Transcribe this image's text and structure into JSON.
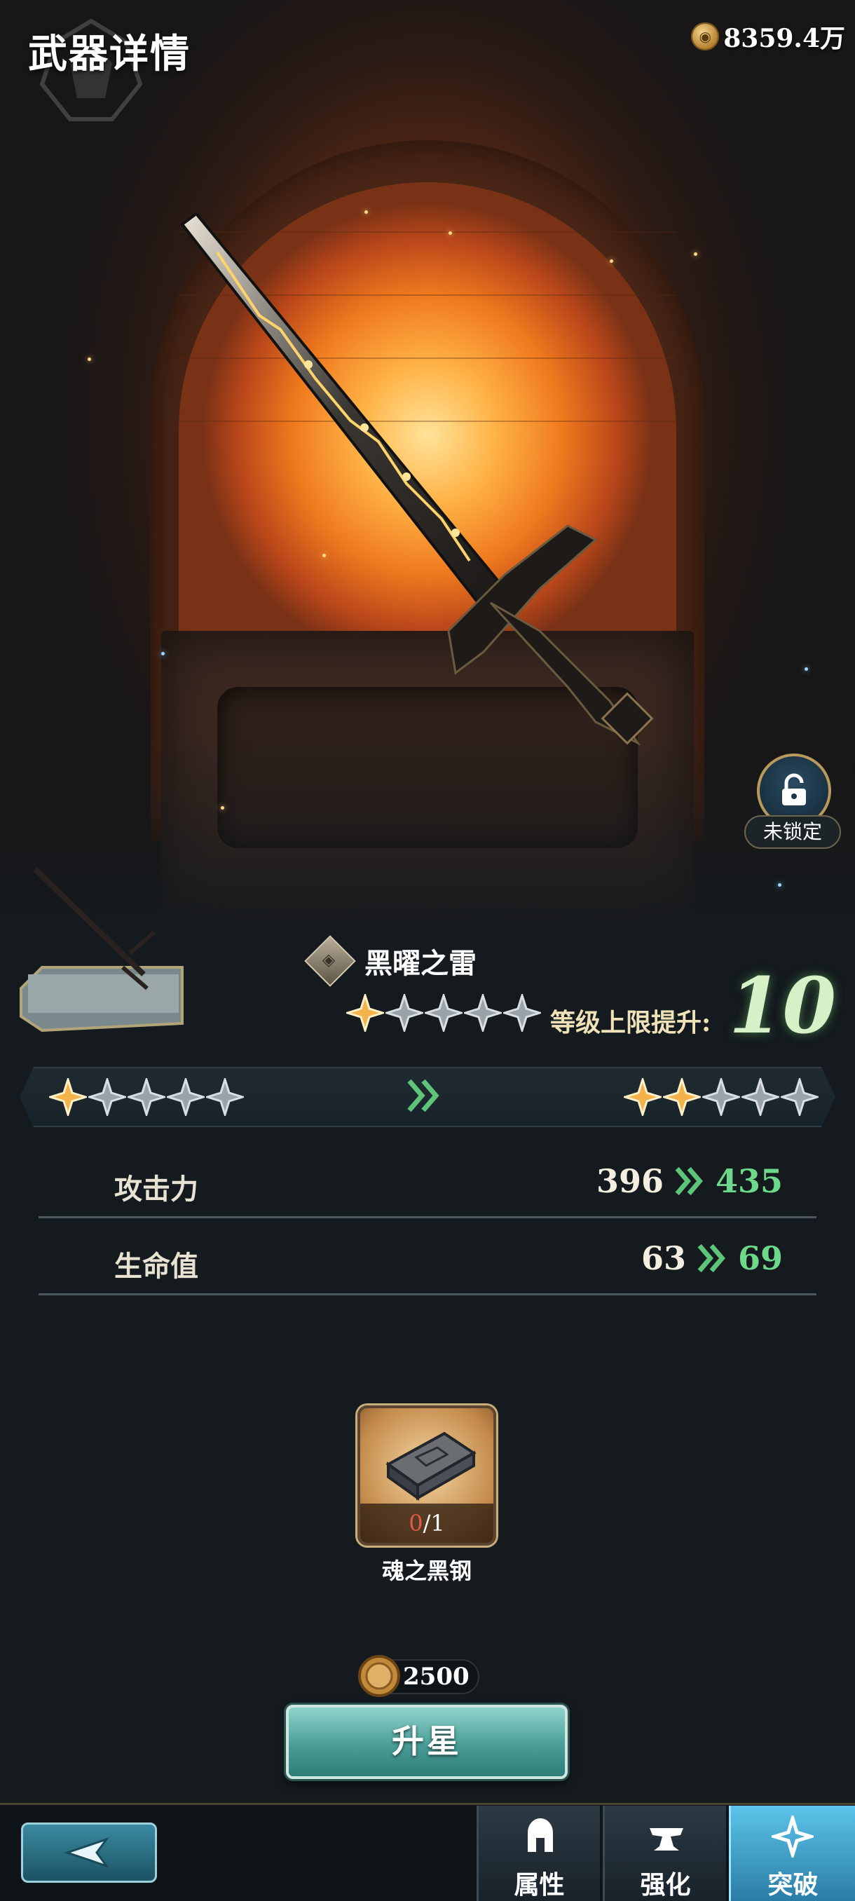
{
  "header": {
    "title": "武器详情",
    "currency_amount": "8359.4万"
  },
  "lock": {
    "label": "未锁定"
  },
  "weapon": {
    "name": "黑曜之雷",
    "current_stars": 1,
    "max_stars": 5,
    "level_cap_label": "等级上限提升:",
    "level_cap_value": "10"
  },
  "star_compare": {
    "from_stars": 1,
    "to_stars": 2,
    "max_stars": 5
  },
  "stats": [
    {
      "label": "攻击力",
      "old": "396",
      "new": "435"
    },
    {
      "label": "生命值",
      "old": "63",
      "new": "69"
    }
  ],
  "material": {
    "name": "魂之黑钢",
    "owned": "0",
    "required": "/1"
  },
  "cost": {
    "amount": "2500"
  },
  "upgrade_button": {
    "label": "升星"
  },
  "nav": {
    "tabs": [
      {
        "label": "属性",
        "icon": "helmet-icon",
        "active": false
      },
      {
        "label": "强化",
        "icon": "anvil-icon",
        "active": false
      },
      {
        "label": "突破",
        "icon": "shuriken-icon",
        "active": true
      }
    ]
  },
  "colors": {
    "accent_green": "#6ed88a",
    "gold": "#b07a2a",
    "teal_button": "#4a9e98",
    "active_tab": "#2a7ca6"
  }
}
